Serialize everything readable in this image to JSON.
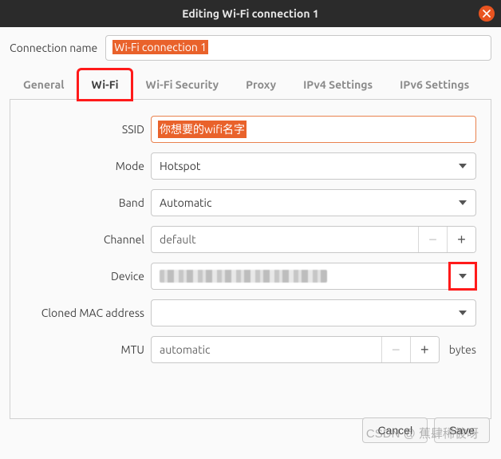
{
  "title": "Editing Wi-Fi connection 1",
  "connection_name_label": "Connection name",
  "connection_name_value": "Wi-Fi connection 1",
  "tabs": [
    "General",
    "Wi-Fi",
    "Wi-Fi Security",
    "Proxy",
    "IPv4 Settings",
    "IPv6 Settings"
  ],
  "active_tab_index": 1,
  "form": {
    "ssid_label": "SSID",
    "ssid_value": "你想要的wifi名字",
    "mode_label": "Mode",
    "mode_value": "Hotspot",
    "band_label": "Band",
    "band_value": "Automatic",
    "channel_label": "Channel",
    "channel_value": "default",
    "device_label": "Device",
    "cloned_mac_label": "Cloned MAC address",
    "mtu_label": "MTU",
    "mtu_value": "automatic",
    "mtu_unit": "bytes"
  },
  "buttons": {
    "cancel": "Cancel",
    "save": "Save"
  },
  "watermark": "CSDN @ 蕉肆稀彼呀"
}
